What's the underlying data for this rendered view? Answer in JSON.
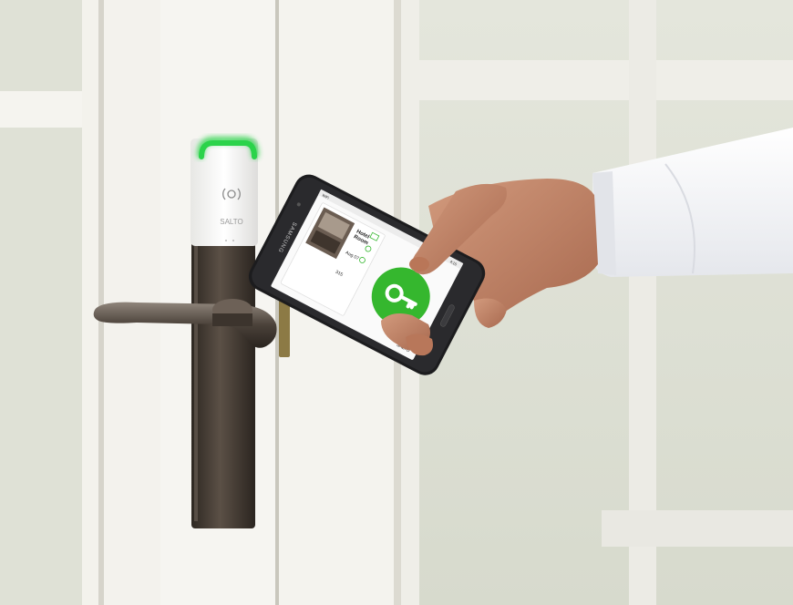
{
  "photo": {
    "subject": "hand-holding-phone-to-door-lock"
  },
  "lock": {
    "brand": "SALTO",
    "led_color": "#2bd34a",
    "nfc_icon": "contactless-icon"
  },
  "phone": {
    "brand": "SAMSUNG",
    "screen": {
      "status_left": "WiFi",
      "status_right": "4:15",
      "hotel_title": "Hotel\nRoom",
      "date_label": "Aug 07",
      "room_number": "315",
      "app_brand": "SALTO",
      "unlock_button_color": "#35b72e",
      "key_icon": "key-icon"
    }
  },
  "colors": {
    "wall": "#ebe9e2",
    "door_frame": "#f2f1ec",
    "lock_metal": "#4a4036",
    "shirt": "#f4f5f7",
    "skin": "#c6896c",
    "phone_body": "#1d1d1f",
    "accent_green": "#2bd34a"
  }
}
